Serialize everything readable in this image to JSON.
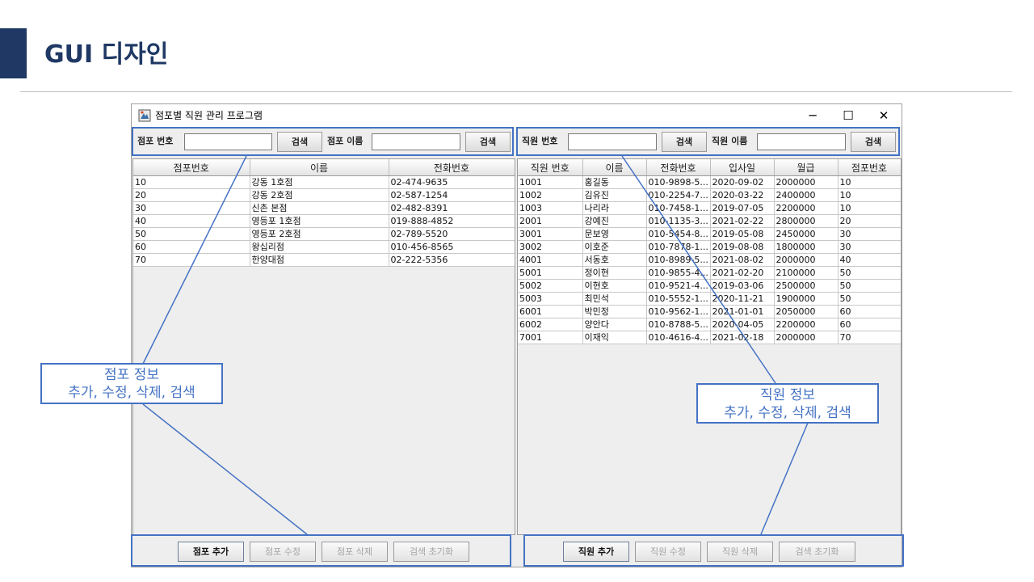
{
  "slide": {
    "title": "GUI 디자인"
  },
  "window": {
    "title": "점포별 직원 관리 프로그램",
    "controls": {
      "minimize": "─",
      "maximize": "☐",
      "close": "✕"
    }
  },
  "store_panel": {
    "search": {
      "number_label": "점포 번호",
      "number_value": "",
      "search_btn_1": "검색",
      "name_label": "점포 이름",
      "name_value": "",
      "search_btn_2": "검색"
    },
    "table": {
      "headers": [
        "점포번호",
        "이름",
        "전화번호"
      ],
      "rows": [
        [
          "10",
          "강동 1호점",
          "02-474-9635"
        ],
        [
          "20",
          "강동 2호점",
          "02-587-1254"
        ],
        [
          "30",
          "신촌 본점",
          "02-482-8391"
        ],
        [
          "40",
          "영등포 1호점",
          "019-888-4852"
        ],
        [
          "50",
          "영등포 2호점",
          "02-789-5520"
        ],
        [
          "60",
          "왕십리점",
          "010-456-8565"
        ],
        [
          "70",
          "한양대점",
          "02-222-5356"
        ]
      ]
    },
    "buttons": {
      "add": "점포 추가",
      "edit": "점포 수정",
      "delete": "점포 삭제",
      "reset": "검색 초기화"
    }
  },
  "employee_panel": {
    "search": {
      "number_label": "직원 번호",
      "number_value": "",
      "search_btn_1": "검색",
      "name_label": "직원 이름",
      "name_value": "",
      "search_btn_2": "검색"
    },
    "table": {
      "headers": [
        "직원 번호",
        "이름",
        "전화번호",
        "입사일",
        "월급",
        "점포번호"
      ],
      "rows": [
        [
          "1001",
          "홍길동",
          "010-9898-5...",
          "2020-09-02",
          "2000000",
          "10"
        ],
        [
          "1002",
          "김유진",
          "010-2254-7...",
          "2020-03-22",
          "2400000",
          "10"
        ],
        [
          "1003",
          "나리라",
          "010-7458-1...",
          "2019-07-05",
          "2200000",
          "10"
        ],
        [
          "2001",
          "강예진",
          "010-1135-3...",
          "2021-02-22",
          "2800000",
          "20"
        ],
        [
          "3001",
          "문보영",
          "010-5454-8...",
          "2019-05-08",
          "2450000",
          "30"
        ],
        [
          "3002",
          "이호준",
          "010-7878-1...",
          "2019-08-08",
          "1800000",
          "30"
        ],
        [
          "4001",
          "서동호",
          "010-8989-5...",
          "2021-08-02",
          "2000000",
          "40"
        ],
        [
          "5001",
          "정이현",
          "010-9855-4...",
          "2021-02-20",
          "2100000",
          "50"
        ],
        [
          "5002",
          "이현호",
          "010-9521-4...",
          "2019-03-06",
          "2500000",
          "50"
        ],
        [
          "5003",
          "최민석",
          "010-5552-1...",
          "2020-11-21",
          "1900000",
          "50"
        ],
        [
          "6001",
          "박민정",
          "010-9562-1...",
          "2021-01-01",
          "2050000",
          "60"
        ],
        [
          "6002",
          "양안다",
          "010-8788-5...",
          "2020-04-05",
          "2200000",
          "60"
        ],
        [
          "7001",
          "이재익",
          "010-4616-4...",
          "2021-02-18",
          "2000000",
          "70"
        ]
      ]
    },
    "buttons": {
      "add": "직원 추가",
      "edit": "직원 수정",
      "delete": "직원 삭제",
      "reset": "검색 초기화"
    }
  },
  "callouts": {
    "store": {
      "line1": "점포 정보",
      "line2": "추가, 수정, 삭제, 검색"
    },
    "employee": {
      "line1": "직원 정보",
      "line2": "추가, 수정, 삭제, 검색"
    }
  },
  "colors": {
    "accent": "#4472c4",
    "title": "#1f3864"
  }
}
